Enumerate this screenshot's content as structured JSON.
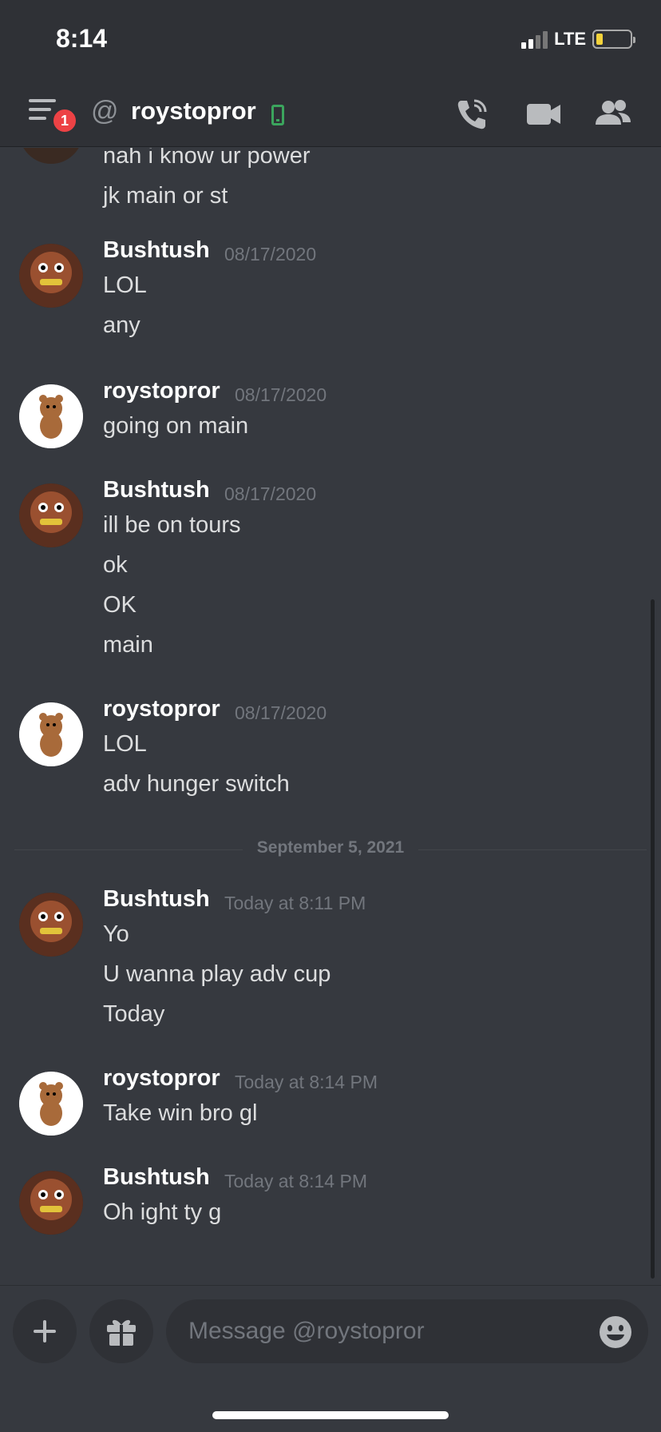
{
  "status_bar": {
    "time": "8:14",
    "network": "LTE",
    "battery_level": 0.15
  },
  "header": {
    "badge_count": "1",
    "at_symbol": "@",
    "title": "roystopror",
    "icons": [
      "menu-icon",
      "at-icon",
      "mobile-status-icon",
      "call-icon",
      "video-icon",
      "members-icon"
    ]
  },
  "messages": {
    "m0": {
      "lines": [
        "nah i know ur power",
        "jk main or st"
      ]
    },
    "m1": {
      "author": "Bushtush",
      "time": "08/17/2020",
      "lines": [
        "LOL",
        "any"
      ]
    },
    "m2": {
      "author": "roystopror",
      "time": "08/17/2020",
      "lines": [
        "going on main"
      ]
    },
    "m3": {
      "author": "Bushtush",
      "time": "08/17/2020",
      "lines": [
        "ill be on tours",
        "ok",
        "OK",
        "main"
      ]
    },
    "m4": {
      "author": "roystopror",
      "time": "08/17/2020",
      "lines": [
        "LOL",
        "adv hunger switch"
      ]
    },
    "m5": {
      "author": "Bushtush",
      "time": "Today at 8:11 PM",
      "lines": [
        "Yo",
        "U wanna play adv cup",
        "Today"
      ]
    },
    "m6": {
      "author": "roystopror",
      "time": "Today at 8:14 PM",
      "lines": [
        "Take win bro gl"
      ]
    },
    "m7": {
      "author": "Bushtush",
      "time": "Today at 8:14 PM",
      "lines": [
        "Oh ight ty g"
      ]
    }
  },
  "date_divider": "September 5, 2021",
  "composer": {
    "placeholder": "Message @roystopror"
  },
  "colors": {
    "background": "#36393f",
    "header": "#2f3136",
    "badge": "#ed4245",
    "online_mobile": "#3ba55d"
  }
}
